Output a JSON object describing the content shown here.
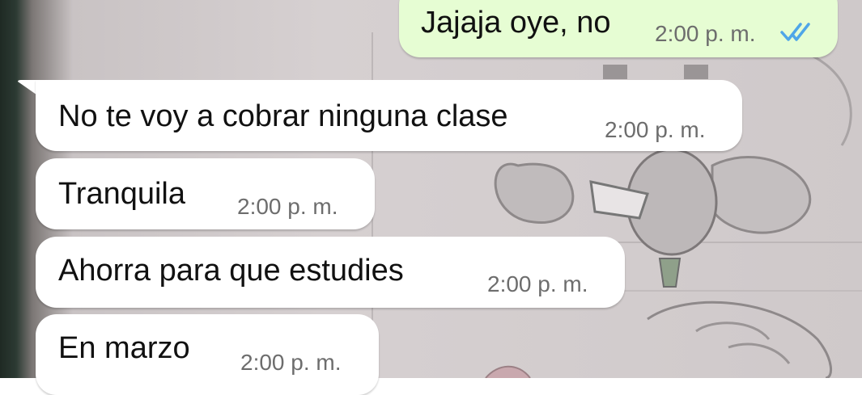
{
  "chat": {
    "messages": [
      {
        "direction": "outgoing",
        "text": "Jajaja oye, no",
        "time": "2:00 p. m.",
        "status_icon": "double-check-read-icon"
      },
      {
        "direction": "incoming",
        "text": "No te voy a cobrar ninguna clase",
        "time": "2:00 p. m."
      },
      {
        "direction": "incoming",
        "text": "Tranquila",
        "time": "2:00 p. m."
      },
      {
        "direction": "incoming",
        "text": "Ahorra para que estudies",
        "time": "2:00 p. m."
      },
      {
        "direction": "incoming",
        "text": "En marzo",
        "time": "2:00 p. m."
      }
    ]
  },
  "colors": {
    "incoming_bubble": "#ffffff",
    "outgoing_bubble": "#e6fdd3",
    "read_check": "#4fa6e8"
  }
}
